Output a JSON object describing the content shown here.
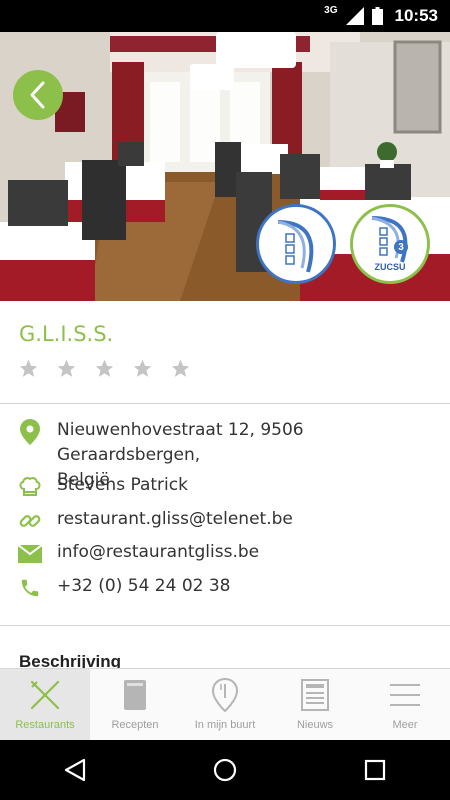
{
  "status_bar": {
    "network": "3G",
    "time": "10:53"
  },
  "restaurant": {
    "name": "G.L.I.S.S.",
    "rating": 0,
    "rating_max": 5
  },
  "details": {
    "address_line1": "Nieuwenhovestraat 12, 9506 Geraardsbergen,",
    "address_line2": "België",
    "chef": "Stevens Patrick",
    "website": "restaurant.gliss@telenet.be",
    "email": "info@restaurantgliss.be",
    "phone": "+32 (0) 54 24 02 38"
  },
  "badges": {
    "badge2_text": "ZUCSU",
    "badge2_number": "3"
  },
  "sections": {
    "description_title": "Beschrijving"
  },
  "bottom_nav": {
    "items": [
      {
        "label": "Restaurants",
        "icon": "fork-knife-icon",
        "active": true
      },
      {
        "label": "Recepten",
        "icon": "book-icon",
        "active": false
      },
      {
        "label": "In mijn buurt",
        "icon": "map-pin-icon",
        "active": false
      },
      {
        "label": "Nieuws",
        "icon": "newspaper-icon",
        "active": false
      },
      {
        "label": "Meer",
        "icon": "menu-icon",
        "active": false
      }
    ]
  },
  "colors": {
    "accent": "#8dc04a",
    "badge_blue": "#3f74c2",
    "star_grey": "#c4c4c4",
    "text": "#333333"
  }
}
